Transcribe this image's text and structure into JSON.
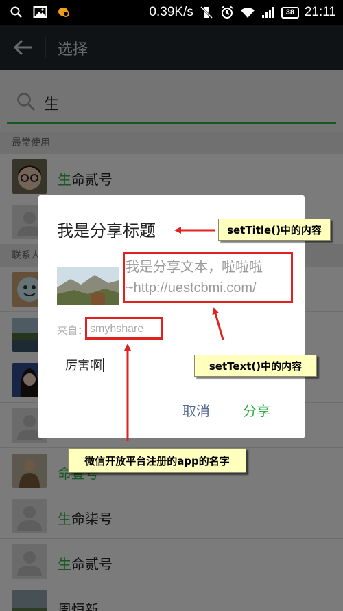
{
  "status_bar": {
    "speed": "0.39K/s",
    "battery": "38",
    "time": "21:11",
    "icons": [
      "search-icon",
      "picture-icon",
      "uc-browser-icon",
      "vibrate-off-icon",
      "alarm-icon",
      "wifi-icon",
      "signal-icon",
      "battery-icon"
    ]
  },
  "app_bar": {
    "title": "选择",
    "back_icon": "arrow-left-icon"
  },
  "search": {
    "query": "生",
    "icon": "search-icon"
  },
  "list": {
    "section_recent": "最常使用",
    "section_contacts": "联系人",
    "rows": [
      {
        "highlight": "生",
        "rest": "命贰号",
        "avatar": "photo-girl"
      },
      {
        "highlight": "",
        "rest": "",
        "avatar": "default-avatar"
      },
      {
        "highlight": "",
        "rest": "",
        "avatar": "photo-emoji"
      },
      {
        "highlight": "",
        "rest": "",
        "avatar": "photo-lake"
      },
      {
        "highlight": "",
        "rest": "",
        "avatar": "photo-woman"
      },
      {
        "highlight": "",
        "rest": "",
        "avatar": "default-avatar"
      },
      {
        "highlight": "",
        "rest": "命壹号",
        "avatar": "photo-man"
      },
      {
        "highlight": "生",
        "rest": "命柒号",
        "avatar": "default-avatar"
      },
      {
        "highlight": "生",
        "rest": "命贰号",
        "avatar": "default-avatar"
      },
      {
        "highlight": "",
        "rest": "周恒新",
        "avatar": "photo-landscape"
      }
    ]
  },
  "dialog": {
    "title": "我是分享标题",
    "share_text_line1": "我是分享文本，啦啦啦",
    "share_text_line2": "~http://uestcbmi.com/",
    "from_label": "来自：",
    "from_value": "smyhshare",
    "comment_value": "厉害啊",
    "cancel_label": "取消",
    "share_label": "分享"
  },
  "annotations": {
    "title_callout": "setTitle()中的内容",
    "text_callout": "setText()中的内容",
    "app_callout": "微信开放平台注册的app的名字",
    "box_color": "#e12020",
    "callout_bg": "#ffffbe"
  },
  "colors": {
    "accent_green": "#2eaf43",
    "link_blue": "#576b95",
    "app_bar": "#21272c"
  }
}
